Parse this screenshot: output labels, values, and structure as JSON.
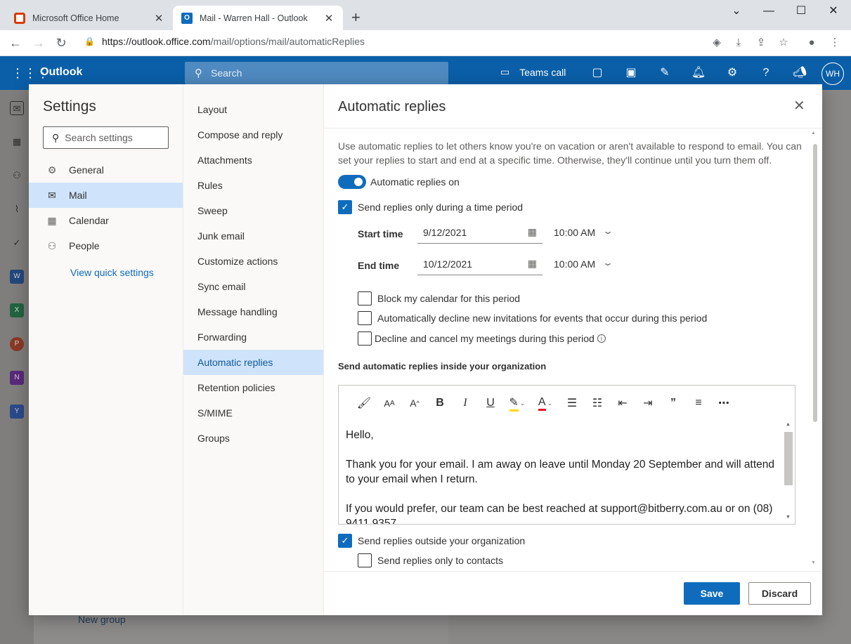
{
  "browser": {
    "tabs": [
      {
        "title": "Microsoft Office Home",
        "favicon": "office-icon",
        "color": "#d83b01"
      },
      {
        "title": "Mail - Warren Hall - Outlook",
        "favicon": "outlook-icon",
        "color": "#0f6cbd"
      }
    ],
    "url_host": "https://outlook.office.com",
    "url_path": "/mail/options/mail/automaticReplies"
  },
  "outlook": {
    "brand": "Outlook",
    "search_placeholder": "Search",
    "teams_call": "Teams call",
    "avatar_initials": "WH",
    "header_color": "#0a5fa8"
  },
  "background": {
    "new_group": "New group"
  },
  "settings": {
    "title": "Settings",
    "search_placeholder": "Search settings",
    "categories": [
      {
        "label": "General",
        "icon": "gear-icon"
      },
      {
        "label": "Mail",
        "icon": "mail-icon",
        "selected": true
      },
      {
        "label": "Calendar",
        "icon": "calendar-icon"
      },
      {
        "label": "People",
        "icon": "people-icon"
      }
    ],
    "view_quick_settings": "View quick settings",
    "mail_sections": [
      "Layout",
      "Compose and reply",
      "Attachments",
      "Rules",
      "Sweep",
      "Junk email",
      "Customize actions",
      "Sync email",
      "Message handling",
      "Forwarding",
      "Automatic replies",
      "Retention policies",
      "S/MIME",
      "Groups"
    ],
    "selected_section": "Automatic replies"
  },
  "auto_replies": {
    "title": "Automatic replies",
    "description": "Use automatic replies to let others know you're on vacation or aren't available to respond to email. You can set your replies to start and end at a specific time. Otherwise, they'll continue until you turn them off.",
    "toggle_label": "Automatic replies on",
    "toggle_on": true,
    "time_period_label": "Send replies only during a time period",
    "time_period_checked": true,
    "start_label": "Start time",
    "start_date": "9/12/2021",
    "start_time": "10:00 AM",
    "end_label": "End time",
    "end_date": "10/12/2021",
    "end_time": "10:00 AM",
    "block_calendar": "Block my calendar for this period",
    "decline_invites": "Automatically decline new invitations for events that occur during this period",
    "decline_cancel": "Decline and cancel my meetings during this period",
    "inside_label": "Send automatic replies inside your organization",
    "message": {
      "greeting": "Hello,",
      "line1": "Thank you for your email. I am away on leave until Monday 20 September and will attend to your email when I return.",
      "line2": "If you would prefer, our team can be best reached at support@bitberry.com.au or on (08) 9411 9357"
    },
    "outside_label": "Send replies outside your organization",
    "outside_checked": true,
    "contacts_only_label": "Send replies only to contacts",
    "save": "Save",
    "discard": "Discard"
  }
}
